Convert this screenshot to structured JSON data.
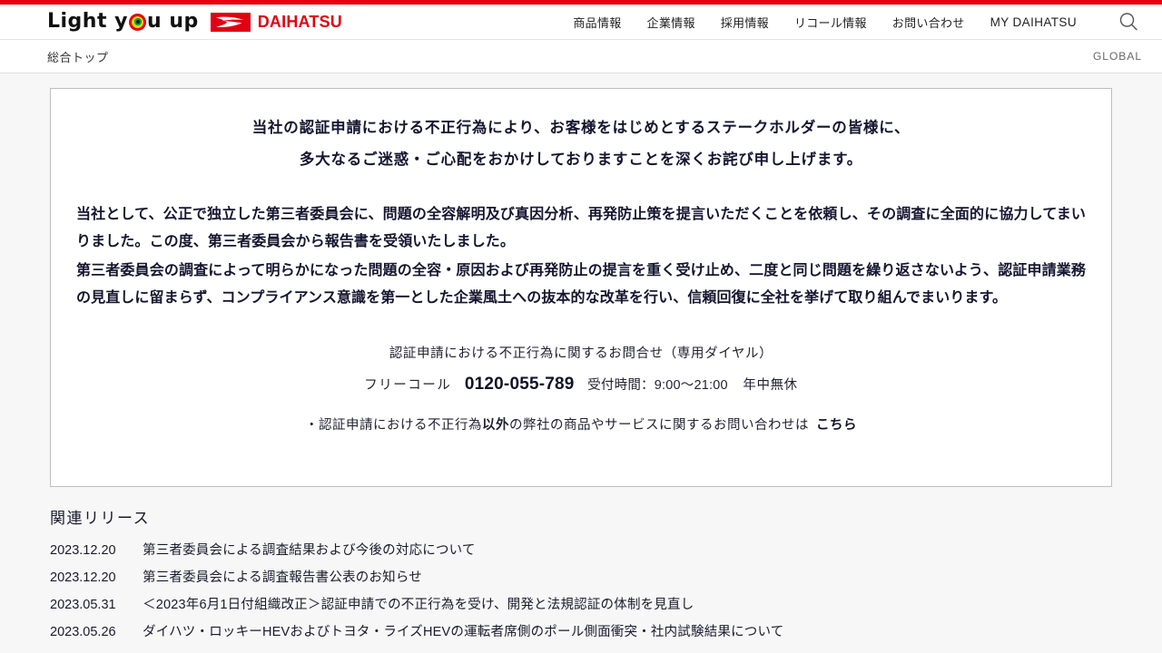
{
  "header": {
    "tagline_before": "Light y",
    "tagline_after": "u up",
    "brand_name": "DAIHATSU",
    "nav": [
      {
        "label": "商品情報",
        "latin": false
      },
      {
        "label": "企業情報",
        "latin": false
      },
      {
        "label": "採用情報",
        "latin": false
      },
      {
        "label": "リコール情報",
        "latin": false
      },
      {
        "label": "お問い合わせ",
        "latin": false
      },
      {
        "label": "MY DAIHATSU",
        "latin": true
      }
    ],
    "search_icon": "search-icon"
  },
  "breadcrumb": {
    "current": "総合トップ",
    "global_label": "GLOBAL"
  },
  "notice": {
    "headline_line1": "当社の認証申請における不正行為により、お客様をはじめとするステークホルダーの皆様に、",
    "headline_line2": "多大なるご迷惑・ご心配をおかけしておりますことを深くお詫び申し上げます。",
    "paragraph1": "当社として、公正で独立した第三者委員会に、問題の全容解明及び真因分析、再発防止策を提言いただくことを依頼し、その調査に全面的に協力してまいりました。この度、第三者委員会から報告書を受領いたしました。",
    "paragraph2": "第三者委員会の調査によって明らかになった問題の全容・原因および再発防止の提言を重く受け止め、二度と同じ問題を繰り返さないよう、認証申請業務の見直しに留まらず、コンプライアンス意識を第一とした企業風土への抜本的な改革を行い、信頼回復に全社を挙げて取り組んでまいります。",
    "contact_title": "認証申請における不正行為に関するお問合せ（専用ダイヤル）",
    "freecall_label": "フリーコール",
    "phone_number": "0120-055-789",
    "hours": "受付時間：9:00〜21:00",
    "year_round": "年中無休",
    "other_inquiry_prefix": "・認証申請における不正行為",
    "other_inquiry_bold": "以外",
    "other_inquiry_suffix": "の弊社の商品やサービスに関するお問い合わせは",
    "other_inquiry_link": "こちら"
  },
  "releases": {
    "title": "関連リリース",
    "items": [
      {
        "date": "2023.12.20",
        "title": "第三者委員会による調査結果および今後の対応について"
      },
      {
        "date": "2023.12.20",
        "title": "第三者委員会による調査報告書公表のお知らせ"
      },
      {
        "date": "2023.05.31",
        "title": "＜2023年6月1日付組織改正＞認証申請での不正行為を受け、開発と法規認証の体制を見直し"
      },
      {
        "date": "2023.05.26",
        "title": "ダイハツ・ロッキーHEVおよびトヨタ・ライズHEVの運転者席側のポール側面衝突・社内試験結果について"
      }
    ]
  },
  "colors": {
    "brand_red": "#e00012",
    "top_strip": "#e50012",
    "ring_outer": "#e50012",
    "ring_mid": "#f5d200",
    "ring_inner": "#00a040",
    "page_bg": "#f7f7f7",
    "text": "#1a1a2e"
  }
}
